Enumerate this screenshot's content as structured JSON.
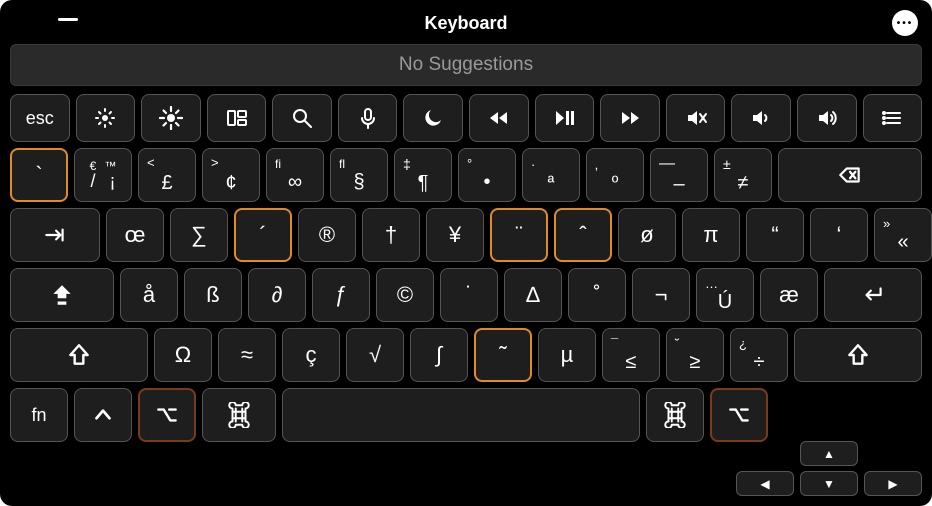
{
  "window": {
    "title": "Keyboard",
    "suggestions_text": "No Suggestions"
  },
  "function_row": [
    {
      "name": "escape-key",
      "label": "esc",
      "icon": null
    },
    {
      "name": "brightness-down-key",
      "icon": "brightness-low"
    },
    {
      "name": "brightness-up-key",
      "icon": "brightness-high"
    },
    {
      "name": "mission-control-key",
      "icon": "mission"
    },
    {
      "name": "spotlight-key",
      "icon": "search"
    },
    {
      "name": "dictation-key",
      "icon": "mic"
    },
    {
      "name": "do-not-disturb-key",
      "icon": "moon"
    },
    {
      "name": "rewind-key",
      "icon": "rewind"
    },
    {
      "name": "play-pause-key",
      "icon": "playpause"
    },
    {
      "name": "forward-key",
      "icon": "forward"
    },
    {
      "name": "mute-key",
      "icon": "mute"
    },
    {
      "name": "volume-down-key",
      "icon": "vol-low"
    },
    {
      "name": "volume-up-key",
      "icon": "vol-high"
    },
    {
      "name": "options-key",
      "icon": "list"
    }
  ],
  "row1": {
    "keys": [
      {
        "name": "grave-key",
        "label": "`",
        "highlight": "orange"
      },
      {
        "name": "slash-exclaim-key",
        "label": "/",
        "alt": "¡",
        "tm": "™",
        "euro": "€"
      },
      {
        "name": "pound-key",
        "label": "£",
        "alt": "<"
      },
      {
        "name": "cent-key",
        "label": "¢",
        "alt": ">"
      },
      {
        "name": "infinity-key",
        "label": "∞",
        "alt": "fi"
      },
      {
        "name": "section-key",
        "label": "§",
        "alt": "fl"
      },
      {
        "name": "pilcrow-key",
        "label": "¶",
        "alt": "‡"
      },
      {
        "name": "bullet-key",
        "label": "•",
        "alt": "°"
      },
      {
        "name": "ordfem-key",
        "label": "ª",
        "alt": "·"
      },
      {
        "name": "ordmasc-key",
        "label": "º",
        "alt": "‚"
      },
      {
        "name": "endash-key",
        "label": "–",
        "alt": "—"
      },
      {
        "name": "notequal-key",
        "label": "≠",
        "alt": "±"
      }
    ],
    "backspace": {
      "name": "delete-key",
      "icon": "backspace"
    }
  },
  "row2": {
    "tab": {
      "name": "tab-key",
      "icon": "tab"
    },
    "keys": [
      {
        "name": "oe-key",
        "label": "œ"
      },
      {
        "name": "sigma-key",
        "label": "∑"
      },
      {
        "name": "acute-key",
        "label": "´",
        "highlight": "orange"
      },
      {
        "name": "registered-key",
        "label": "®"
      },
      {
        "name": "dagger-key",
        "label": "†"
      },
      {
        "name": "yen-key",
        "label": "¥"
      },
      {
        "name": "diaeresis-key",
        "label": "¨",
        "highlight": "orange"
      },
      {
        "name": "caret-key",
        "label": "ˆ",
        "highlight": "orange"
      },
      {
        "name": "oslash-key",
        "label": "ø"
      },
      {
        "name": "pi-key",
        "label": "π"
      },
      {
        "name": "ldquo-key",
        "label": "“"
      },
      {
        "name": "lsquo-key",
        "label": "‘"
      },
      {
        "name": "guillemet-key",
        "label": "«",
        "alt": "»"
      }
    ]
  },
  "row3": {
    "caps": {
      "name": "caps-lock-key",
      "icon": "capslock"
    },
    "keys": [
      {
        "name": "aring-key",
        "label": "å"
      },
      {
        "name": "eszett-key",
        "label": "ß"
      },
      {
        "name": "partial-key",
        "label": "∂"
      },
      {
        "name": "fhook-key",
        "label": "ƒ"
      },
      {
        "name": "copyright-key",
        "label": "©"
      },
      {
        "name": "overdot-key",
        "label": "˙"
      },
      {
        "name": "delta-key",
        "label": "∆"
      },
      {
        "name": "ring-accent-key",
        "label": "˚"
      },
      {
        "name": "not-key",
        "label": "¬"
      },
      {
        "name": "u-acute-key",
        "label": "Ú",
        "alt": "…"
      },
      {
        "name": "ae-key",
        "label": "æ"
      }
    ],
    "enter": {
      "name": "return-key",
      "icon": "return"
    }
  },
  "row4": {
    "lshift": {
      "name": "left-shift-key",
      "icon": "shift"
    },
    "keys": [
      {
        "name": "omega-key",
        "label": "Ω"
      },
      {
        "name": "approx-key",
        "label": "≈"
      },
      {
        "name": "ccedilla-key",
        "label": "ç"
      },
      {
        "name": "sqrt-key",
        "label": "√"
      },
      {
        "name": "integral-key",
        "label": "∫"
      },
      {
        "name": "tilde-key",
        "label": "˜",
        "highlight": "orange"
      },
      {
        "name": "mu-key",
        "label": "µ"
      },
      {
        "name": "lessequal-key",
        "label": "≤",
        "alt": "¯"
      },
      {
        "name": "greaterequal-key",
        "label": "≥",
        "alt": "˘"
      },
      {
        "name": "division-key",
        "label": "÷",
        "alt": "¿"
      }
    ],
    "rshift": {
      "name": "right-shift-key",
      "icon": "shift"
    }
  },
  "row5": {
    "fn": {
      "name": "fn-key",
      "label": "fn"
    },
    "lctrl": {
      "name": "left-control-key",
      "icon": "control"
    },
    "lopt": {
      "name": "left-option-key",
      "icon": "option",
      "highlight": "darkorange"
    },
    "lcmd": {
      "name": "left-command-key",
      "icon": "command"
    },
    "space": {
      "name": "spacebar-key"
    },
    "rcmd": {
      "name": "right-command-key",
      "icon": "command"
    },
    "ropt": {
      "name": "right-option-key",
      "icon": "option",
      "highlight": "darkorange"
    },
    "arrows": {
      "up": {
        "name": "arrow-up-key",
        "label": "▲"
      },
      "left": {
        "name": "arrow-left-key",
        "label": "◀"
      },
      "down": {
        "name": "arrow-down-key",
        "label": "▼"
      },
      "right": {
        "name": "arrow-right-key",
        "label": "▶"
      }
    }
  }
}
